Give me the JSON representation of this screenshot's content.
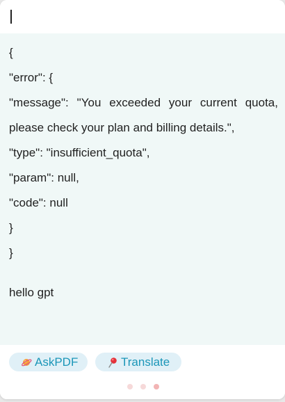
{
  "input": {
    "value": ""
  },
  "response": {
    "lines": [
      "{",
      "\"error\": {",
      "\"message\": \"You exceeded your current quota,",
      "please check your plan and billing details.\",",
      "\"type\": \"insufficient_quota\",",
      "\"param\": null,",
      "\"code\": null",
      "}",
      "}"
    ],
    "prompt": "hello gpt"
  },
  "toolbar": {
    "askpdf_label": "AskPDF",
    "askpdf_icon": "planet-icon",
    "translate_label": "Translate",
    "translate_icon": "pin-icon"
  },
  "pagination": {
    "total": 3,
    "active_index": 2,
    "colors": {
      "inactive": "#f6d9d9",
      "active": "#f2b4b4"
    }
  },
  "colors": {
    "response_bg": "#f0f8f7",
    "chip_bg": "#e0f0f7",
    "chip_text": "#1b96b8"
  }
}
